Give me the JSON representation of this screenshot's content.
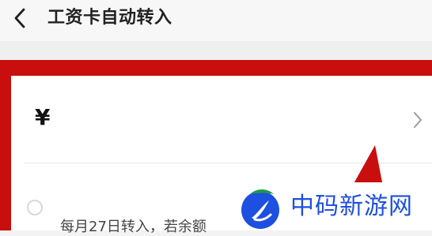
{
  "header": {
    "back_icon": "chevron-left-icon",
    "title": "工资卡自动转入"
  },
  "amount": {
    "currency_symbol": "¥",
    "value": "",
    "chevron_icon": "chevron-right-icon"
  },
  "schedule": {
    "text": "每月27日转入，若余额"
  },
  "watermark": {
    "logo_icon": "brand-logo-icon",
    "text": "中码新游网"
  },
  "colors": {
    "highlight": "#c90e0e",
    "watermark_blue": "#1d4fe0",
    "logo_green": "#1f9a46"
  }
}
